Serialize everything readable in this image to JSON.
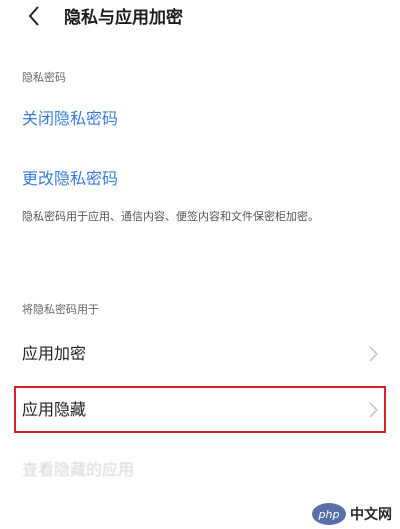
{
  "header": {
    "title": "隐私与应用加密"
  },
  "section1": {
    "label": "隐私密码"
  },
  "links": {
    "close_password": "关闭隐私密码",
    "change_password": "更改隐私密码"
  },
  "description": "隐私密码用于应用、通信内容、便签内容和文件保密柜加密。",
  "section2": {
    "label": "将隐私密码用于"
  },
  "rows": {
    "app_encryption": "应用加密",
    "app_hide": "应用隐藏",
    "view_hidden": "查看隐藏的应用"
  },
  "watermark": {
    "logo": "php",
    "text": "中文网"
  },
  "colors": {
    "link": "#3a7ce0",
    "highlight_border": "#d8202c"
  }
}
